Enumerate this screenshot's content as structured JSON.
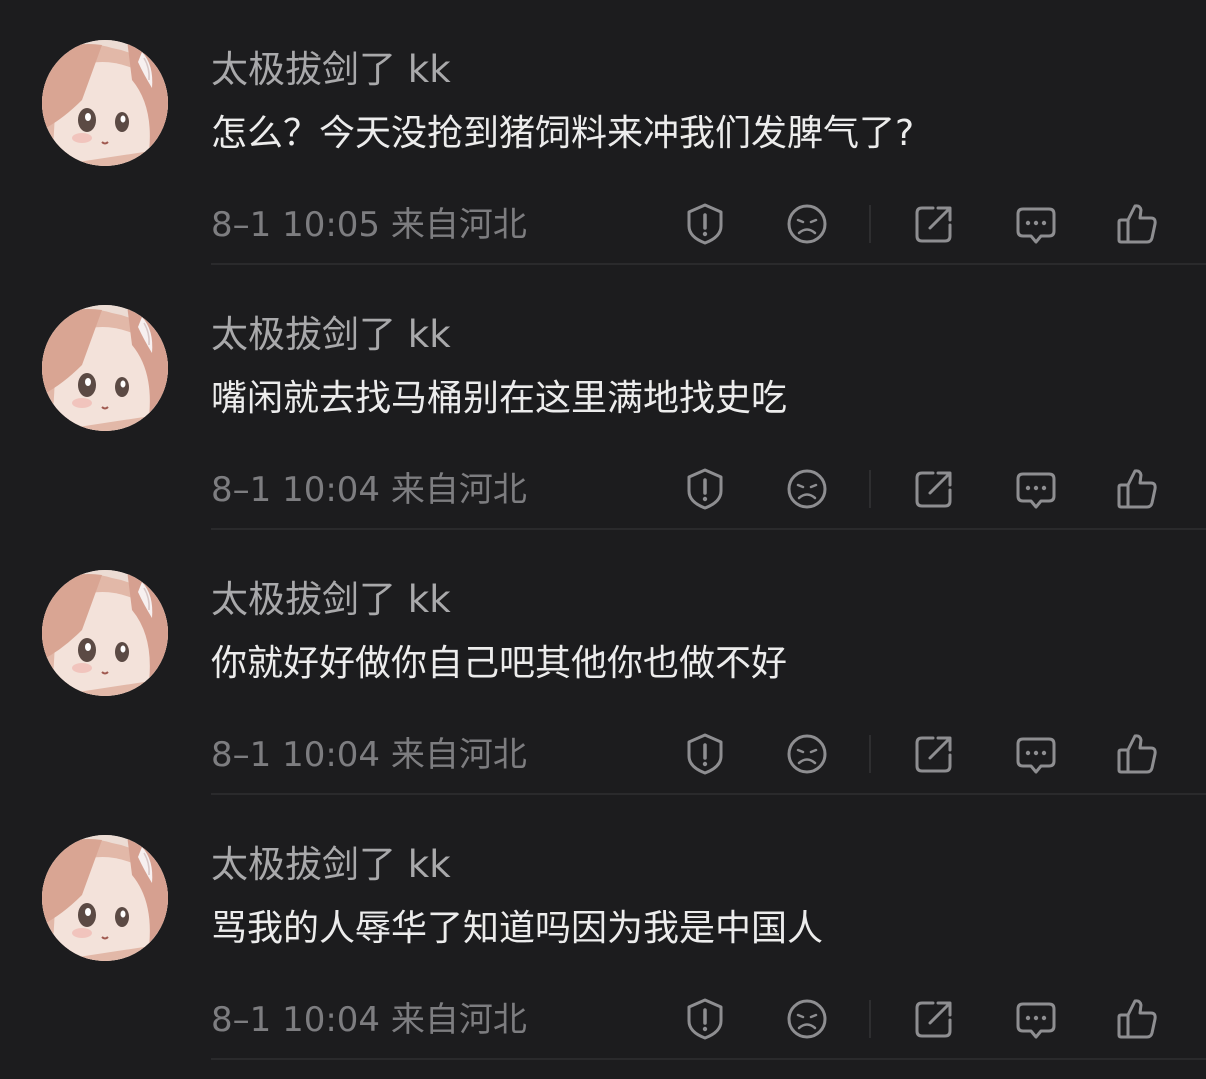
{
  "theme": {
    "background": "#1c1c1e",
    "username_color": "#a9a9ab",
    "content_color": "#ececec",
    "meta_color": "#7d7d80",
    "icon_color": "#8e8e91"
  },
  "comments": [
    {
      "username": "太极拔剑了 kk",
      "content": "怎么？今天没抢到猪饲料来冲我们发脾气了?",
      "time": "8-1 10:05",
      "location": "来自河北",
      "timestamp_line": "8–1 10:05  来自河北"
    },
    {
      "username": "太极拔剑了 kk",
      "content": "嘴闲就去找马桶别在这里满地找史吃",
      "time": "8-1 10:04",
      "location": "来自河北",
      "timestamp_line": "8–1 10:04  来自河北"
    },
    {
      "username": "太极拔剑了 kk",
      "content": "你就好好做你自己吧其他你也做不好",
      "time": "8-1 10:04",
      "location": "来自河北",
      "timestamp_line": "8–1 10:04  来自河北"
    },
    {
      "username": "太极拔剑了 kk",
      "content": "骂我的人辱华了知道吗因为我是中国人",
      "time": "8-1 10:04",
      "location": "来自河北",
      "timestamp_line": "8–1 10:04  来自河北"
    }
  ],
  "action_icons": [
    "report-icon",
    "dislike-icon",
    "share-icon",
    "reply-icon",
    "like-icon"
  ]
}
